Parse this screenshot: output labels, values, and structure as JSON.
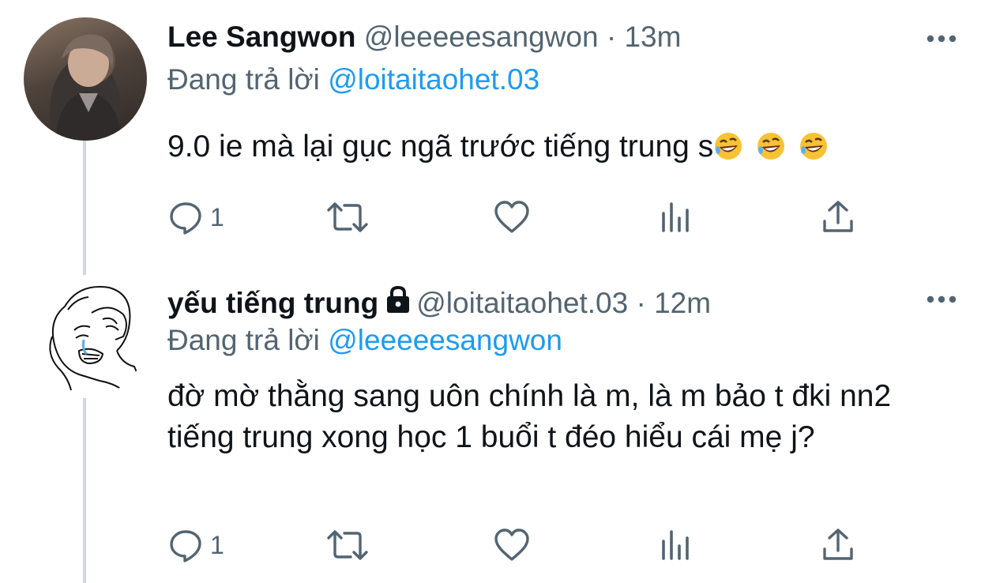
{
  "tweets": [
    {
      "name": "Lee Sangwon",
      "handle": "@leeeeesangwon",
      "dot": "·",
      "time": "13m",
      "reply_prefix": "Đang trả lời",
      "reply_to": "@loitaitaohet.03",
      "body": "9.0 ie mà lại gục ngã trước tiếng trung s",
      "emojis": [
        "rolling-on-floor-laughing",
        "rolling-on-floor-laughing",
        "rolling-on-floor-laughing"
      ],
      "reply_count": "1",
      "locked": false
    },
    {
      "name": "yếu tiếng trung",
      "handle": "@loitaitaohet.03",
      "dot": "·",
      "time": "12m",
      "reply_prefix": "Đang trả lời",
      "reply_to": "@leeeeesangwon",
      "body": "đờ mờ thằng sang uôn chính là m, là m bảo t đki nn2 tiếng trung xong học 1 buổi t đéo hiểu cái mẹ j?",
      "reply_count": "1",
      "locked": true
    }
  ],
  "colors": {
    "link": "#1d9bf0",
    "secondary_text": "#536471",
    "thread_line": "#cfd9de"
  }
}
